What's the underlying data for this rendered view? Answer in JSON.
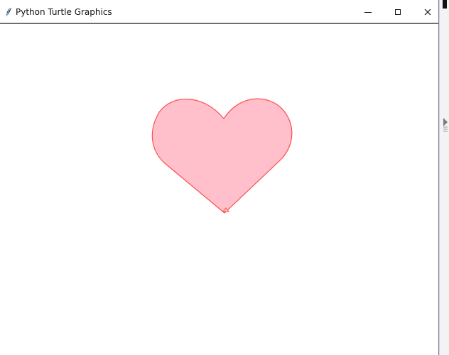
{
  "window": {
    "title": "Python Turtle Graphics",
    "minimize_icon": "minimize-icon",
    "maximize_icon": "maximize-icon",
    "close_icon": "close-icon",
    "app_icon": "feather-icon"
  },
  "canvas": {
    "shape": "heart-icon",
    "fill_color": "#ffc0cb",
    "stroke_color": "#ff4d4d",
    "cursor": "turtle-cursor-icon"
  },
  "colors": {
    "titlebar_background": "#ffffff",
    "canvas_background": "#ffffff",
    "window_border": "#8a70a8"
  }
}
